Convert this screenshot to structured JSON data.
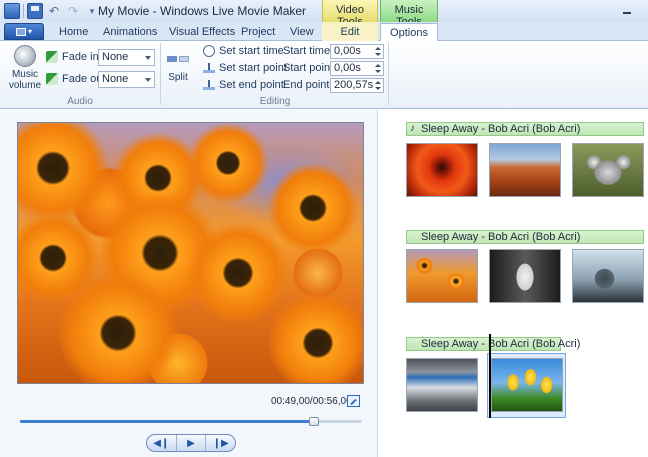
{
  "window": {
    "title": "My Movie - Windows Live Movie Maker"
  },
  "contextual_tabs": {
    "video_tools": "Video Tools",
    "music_tools": "Music Tools"
  },
  "tabs": [
    "Home",
    "Animations",
    "Visual Effects",
    "Project",
    "View",
    "Edit",
    "Options"
  ],
  "active_tab": "Options",
  "ribbon": {
    "audio": {
      "music_volume_label": "Music volume",
      "fade_in_label": "Fade in:",
      "fade_in_value": "None",
      "fade_out_label": "Fade out:",
      "fade_out_value": "None",
      "group_label": "Audio"
    },
    "editing": {
      "split_label": "Split",
      "set_start_time": "Set start time",
      "set_start_point": "Set start point",
      "set_end_point": "Set end point",
      "start_time_label": "Start time:",
      "start_time_value": "0,00s",
      "start_point_label": "Start point:",
      "start_point_value": "0,00s",
      "end_point_label": "End point:",
      "end_point_value": "200,57s",
      "group_label": "Editing"
    }
  },
  "preview": {
    "time_readout": "00:49,00/00:56,00",
    "seek_progress": 0.86
  },
  "storyboard": {
    "rows": [
      {
        "track_label": "Sleep Away - Bob Acri (Bob Acri)",
        "clips": [
          "orange-flower",
          "desert",
          "koala"
        ]
      },
      {
        "track_label": "Sleep Away - Bob Acri (Bob Acri)",
        "clips": [
          "orange-flowers",
          "mug",
          "window-seat"
        ]
      },
      {
        "track_label": "Sleep Away - Bob Acri (Bob Acri)",
        "clips": [
          "conference-room",
          "tulips"
        ]
      }
    ],
    "selected_clip": "tulips"
  }
}
